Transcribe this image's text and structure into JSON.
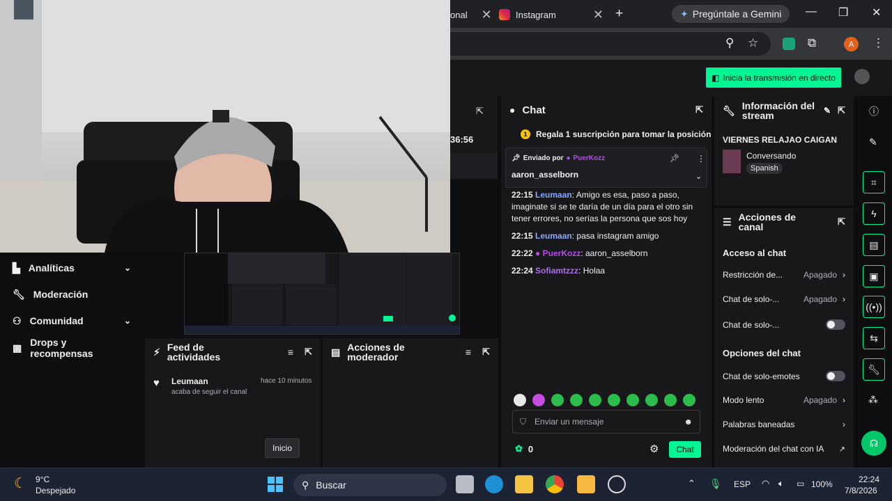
{
  "browser": {
    "tabs": [
      {
        "label": "onal"
      },
      {
        "label": "Instagram"
      }
    ],
    "gemini_label": "Pregúntale a Gemini",
    "profile_initial": "A"
  },
  "header": {
    "go_live_label": "Inicia la transmisión en directo"
  },
  "sidenav": {
    "items": [
      {
        "label": "Analíticas"
      },
      {
        "label": "Moderación"
      },
      {
        "label": "Comunidad"
      },
      {
        "label": "Drops y recompensas"
      }
    ]
  },
  "partial_panel": {
    "time": "36:56"
  },
  "chat": {
    "title": "Chat",
    "gift_banner": "Regala 1 suscripción para tomar la posición",
    "pinned": {
      "sent_by": "Enviado por",
      "user": "PuerKozz",
      "message": "aaron_asselborn"
    },
    "messages": [
      {
        "time": "22:15",
        "user": "Leumaan",
        "text": ": Amigo es esa, paso a paso, imaginate si se te daría de un día para el otro sin tener errores, no serías la persona que sos hoy"
      },
      {
        "time": "22:15",
        "user": "Leumaan",
        "text": ": pasa instagram amigo"
      },
      {
        "time": "22:22",
        "user": "PuerKozz",
        "text": ": aaron_asselborn"
      },
      {
        "time": "22:24",
        "user": "Sofiamtzzz",
        "text": ": Holaa"
      }
    ],
    "input_placeholder": "Enviar un mensaje",
    "points": "0",
    "send_label": "Chat"
  },
  "stream_info": {
    "title": "Información del stream",
    "stream_title": "VIERNES RELAJAO CAIGAN",
    "category": "Conversando",
    "tag": "Spanish"
  },
  "channel_actions": {
    "title": "Acciones de canal",
    "section_access": "Acceso al chat",
    "rows": [
      {
        "label": "Restricción de...",
        "value": "Apagado"
      },
      {
        "label": "Chat de solo-...",
        "value": "Apagado"
      },
      {
        "label": "Chat de solo-...",
        "value": ""
      }
    ],
    "section_options": "Opciones del chat",
    "options": [
      {
        "label": "Chat de solo-emotes",
        "value": ""
      },
      {
        "label": "Modo lento",
        "value": "Apagado"
      },
      {
        "label": "Palabras baneadas",
        "value": ""
      },
      {
        "label": "Moderación del chat con IA",
        "value": ""
      }
    ]
  },
  "activity_feed": {
    "title": "Feed de actividades",
    "event": {
      "user": "Leumaan",
      "time": "hace 10 minutos",
      "desc": "acaba de seguir el canal"
    }
  },
  "mod_actions": {
    "title": "Acciones de moderador"
  },
  "tooltip": {
    "label": "Inicio"
  },
  "taskbar": {
    "weather_temp": "9°C",
    "weather_desc": "Despejado",
    "search_label": "Buscar",
    "lang": "ESP",
    "battery": "100%",
    "time": "22:24",
    "date": "7/8/2026"
  },
  "colors": {
    "accent": "#00f593",
    "user_blue": "#8aa6ff",
    "user_purple": "#b44ee6"
  }
}
